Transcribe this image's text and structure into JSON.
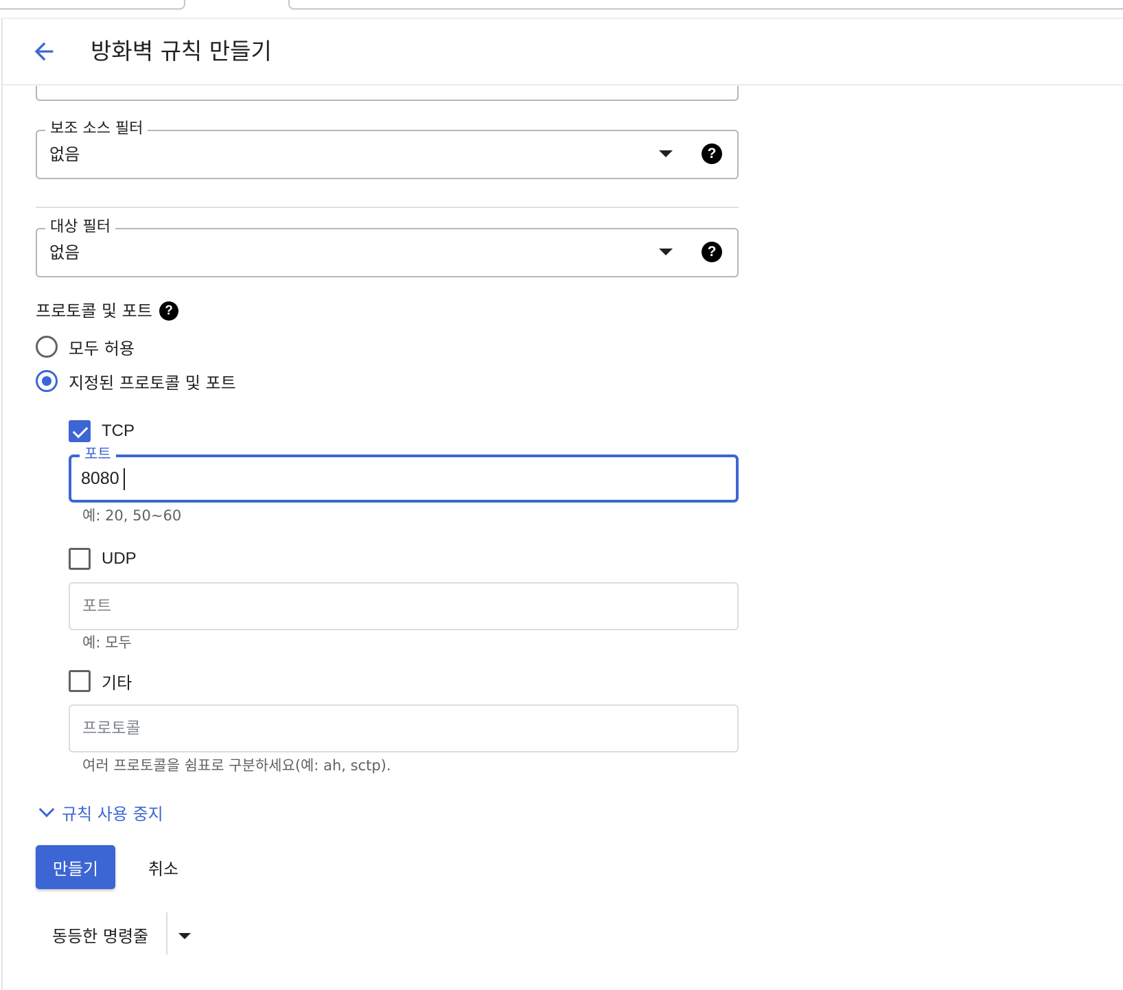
{
  "header": {
    "title": "방화벽 규칙 만들기",
    "back_icon": "arrow-back-icon"
  },
  "secondary_source_filter": {
    "label": "보조 소스 필터",
    "value": "없음",
    "help_icon": "help-icon"
  },
  "target_filter": {
    "label": "대상 필터",
    "value": "없음",
    "help_icon": "help-icon"
  },
  "protocols_ports": {
    "title": "프로토콜 및 포트",
    "radio_all": "모두 허용",
    "radio_specified": "지정된 프로토콜 및 포트",
    "selected": "specified",
    "tcp": {
      "label": "TCP",
      "checked": true,
      "port_label": "포트",
      "port_value": "8080",
      "hint": "예: 20, 50~60"
    },
    "udp": {
      "label": "UDP",
      "checked": false,
      "port_placeholder": "포트",
      "hint": "예: 모두"
    },
    "other": {
      "label": "기타",
      "checked": false,
      "protocol_placeholder": "프로토콜",
      "hint": "여러 프로토콜을 쉼표로 구분하세요(예: ah, sctp)."
    }
  },
  "disable_rule_link": "규칙 사용 중지",
  "actions": {
    "create": "만들기",
    "cancel": "취소"
  },
  "command_line": {
    "label": "동등한 명령줄"
  },
  "colors": {
    "accent": "#3c66d4",
    "text": "#202124",
    "hint": "#5f6368",
    "border": "#b7b7b7"
  }
}
